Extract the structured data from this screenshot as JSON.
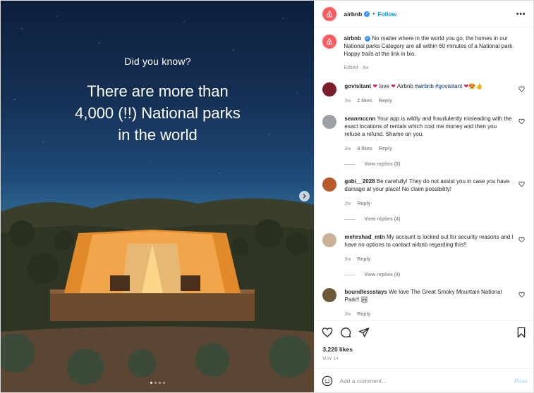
{
  "media": {
    "kicker": "Did you know?",
    "headline_lines": [
      "There are more than",
      "4,000 (!!) National parks",
      "in the world"
    ],
    "carousel_dots": 4,
    "active_dot": 1
  },
  "header": {
    "username": "airbnb",
    "separator": "•",
    "follow_label": "Follow",
    "more_label": "•••"
  },
  "caption": {
    "username": "airbnb",
    "text": "No matter where in the world you go, the homes in our National parks Category are all within 60 minutes of a National park. Happy trails at the link in bio.",
    "meta": "Edited · 3w"
  },
  "comments": [
    {
      "username": "govisitant",
      "text_parts": [
        "love",
        "Airbnb",
        "#airbnb",
        "#govisitant"
      ],
      "age": "3w",
      "likes": "2 likes",
      "reply": "Reply"
    },
    {
      "username": "seanmccnn",
      "text": "Your app is wildly and fraudulently misleading with the exact locations of rentals which cost me money and then you refuse a refund. Shame on you.",
      "age": "3w",
      "likes": "9 likes",
      "reply": "Reply",
      "view_replies": "View replies (5)"
    },
    {
      "username": "gabi__2028",
      "text": "Be carefully! They do not assist you in case you have damage at your place! No claim possibility!",
      "age": "2w",
      "reply": "Reply",
      "view_replies": "View replies (4)"
    },
    {
      "username": "mehrshad_mtn",
      "text": "My account is locked out for security reasons and I have no options to contact airbnb regarding this!!",
      "age": "3w",
      "reply": "Reply",
      "view_replies": "View replies (4)"
    },
    {
      "username": "boundlessstays",
      "text": "We love The Great Smoky Mountain National Park!!",
      "age": "3w",
      "reply": "Reply"
    }
  ],
  "engagement": {
    "likes": "3,220 likes",
    "date": "MAY 14"
  },
  "composer": {
    "placeholder": "Add a comment...",
    "post_label": "Post"
  },
  "colors": {
    "brand": "#ff5a5f",
    "link": "#0095f6",
    "verified": "#3897f0",
    "muted": "#8e8e8e"
  }
}
